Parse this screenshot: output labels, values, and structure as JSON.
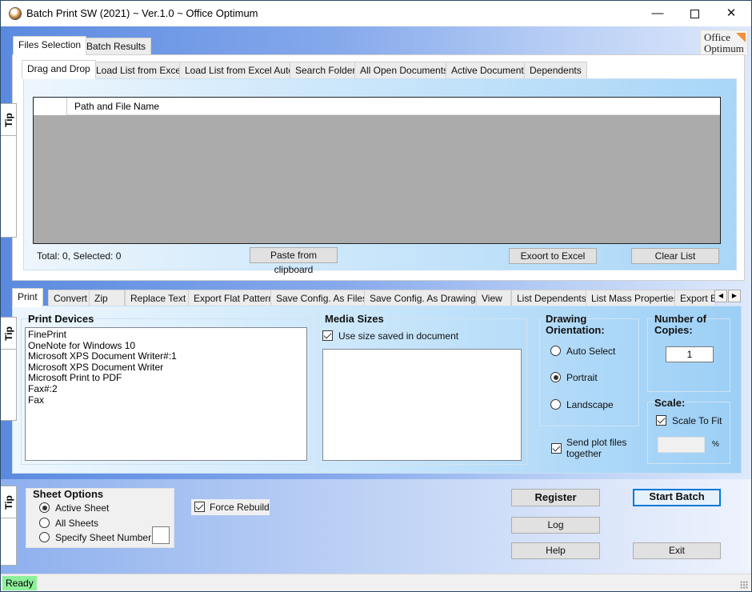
{
  "window": {
    "title": "Batch Print SW (2021) ~ Ver.1.0 ~ Office Optimum",
    "controls": {
      "minimize": "—",
      "close": "✕"
    }
  },
  "logo": {
    "line1": "Office",
    "line2": "Optimum"
  },
  "tip_label": "Tip",
  "top_tabs": [
    {
      "label": "Files Selection",
      "active": true
    },
    {
      "label": "Batch Results",
      "active": false
    }
  ],
  "source_tabs": [
    {
      "label": "Drag and Drop",
      "active": true
    },
    {
      "label": "Load List from Excel"
    },
    {
      "label": "Load List from Excel Auto"
    },
    {
      "label": "Search Folder"
    },
    {
      "label": "All Open Documents"
    },
    {
      "label": "Active Document"
    },
    {
      "label": "Dependents"
    }
  ],
  "file_grid": {
    "columns": [
      "Path and File Name"
    ],
    "rows": []
  },
  "file_list_footer": {
    "status": "Total: 0, Selected: 0",
    "paste_button": "Paste from clipboard",
    "export_button": "Exoort to Excel",
    "clear_button": "Clear List"
  },
  "action_tabs": [
    {
      "label": "Print",
      "active": true
    },
    {
      "label": "Convert"
    },
    {
      "label": "Zip"
    },
    {
      "label": "Replace Text"
    },
    {
      "label": "Export Flat Pattern"
    },
    {
      "label": "Save Config. As Files"
    },
    {
      "label": "Save Config. As Drawings"
    },
    {
      "label": "View"
    },
    {
      "label": "List Dependents"
    },
    {
      "label": "List Mass Properties"
    },
    {
      "label": "Export Bi"
    }
  ],
  "tab_scroll": {
    "left": "◀",
    "right": "▶"
  },
  "print": {
    "devices_title": "Print Devices",
    "devices": [
      "FinePrint",
      "OneNote for Windows 10",
      "Microsoft XPS Document Writer#:1",
      "Microsoft XPS Document Writer",
      "Microsoft Print to PDF",
      "Fax#:2",
      "Fax"
    ],
    "media_title": "Media Sizes",
    "use_saved_size_label": "Use size saved in document",
    "use_saved_size_checked": true,
    "media_sizes": [],
    "orientation_title_1": "Drawing",
    "orientation_title_2": "Orientation:",
    "orientation_options": [
      "Auto Select",
      "Portrait",
      "Landscape"
    ],
    "orientation_selected": "Portrait",
    "send_plot_label_1": "Send plot files",
    "send_plot_label_2": "together",
    "send_plot_checked": true,
    "copies_title_1": "Number of",
    "copies_title_2": "Copies:",
    "copies_value": "1",
    "scale_title": "Scale:",
    "scale_to_fit_label": "Scale To Fit",
    "scale_to_fit_checked": true,
    "scale_percent_value": "",
    "scale_percent_unit": "%"
  },
  "sheet_options": {
    "title": "Sheet Options",
    "options": [
      "Active Sheet",
      "All Sheets",
      "Specify Sheet Number:"
    ],
    "selected": "Active Sheet",
    "sheet_number_value": ""
  },
  "force_rebuild": {
    "label": "Force Rebuild",
    "checked": true
  },
  "buttons": {
    "register": "Register",
    "start_batch": "Start Batch",
    "log": "Log",
    "help": "Help",
    "exit": "Exit"
  },
  "status_bar": {
    "text": "Ready",
    "color": "#8ef09a"
  },
  "colors": {
    "accent": "#0078d7",
    "grid_background": "#ababab",
    "logo_accent": "#f0913b"
  }
}
